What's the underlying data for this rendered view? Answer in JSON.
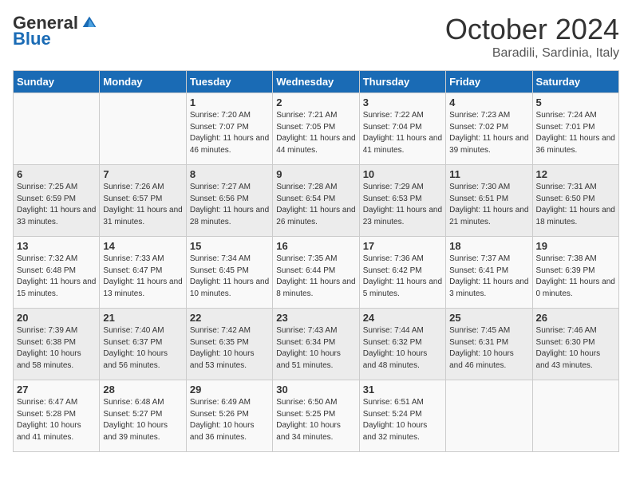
{
  "logo": {
    "general": "General",
    "blue": "Blue"
  },
  "title": "October 2024",
  "subtitle": "Baradili, Sardinia, Italy",
  "days_of_week": [
    "Sunday",
    "Monday",
    "Tuesday",
    "Wednesday",
    "Thursday",
    "Friday",
    "Saturday"
  ],
  "weeks": [
    [
      {
        "day": "",
        "info": ""
      },
      {
        "day": "",
        "info": ""
      },
      {
        "day": "1",
        "info": "Sunrise: 7:20 AM\nSunset: 7:07 PM\nDaylight: 11 hours and 46 minutes."
      },
      {
        "day": "2",
        "info": "Sunrise: 7:21 AM\nSunset: 7:05 PM\nDaylight: 11 hours and 44 minutes."
      },
      {
        "day": "3",
        "info": "Sunrise: 7:22 AM\nSunset: 7:04 PM\nDaylight: 11 hours and 41 minutes."
      },
      {
        "day": "4",
        "info": "Sunrise: 7:23 AM\nSunset: 7:02 PM\nDaylight: 11 hours and 39 minutes."
      },
      {
        "day": "5",
        "info": "Sunrise: 7:24 AM\nSunset: 7:01 PM\nDaylight: 11 hours and 36 minutes."
      }
    ],
    [
      {
        "day": "6",
        "info": "Sunrise: 7:25 AM\nSunset: 6:59 PM\nDaylight: 11 hours and 33 minutes."
      },
      {
        "day": "7",
        "info": "Sunrise: 7:26 AM\nSunset: 6:57 PM\nDaylight: 11 hours and 31 minutes."
      },
      {
        "day": "8",
        "info": "Sunrise: 7:27 AM\nSunset: 6:56 PM\nDaylight: 11 hours and 28 minutes."
      },
      {
        "day": "9",
        "info": "Sunrise: 7:28 AM\nSunset: 6:54 PM\nDaylight: 11 hours and 26 minutes."
      },
      {
        "day": "10",
        "info": "Sunrise: 7:29 AM\nSunset: 6:53 PM\nDaylight: 11 hours and 23 minutes."
      },
      {
        "day": "11",
        "info": "Sunrise: 7:30 AM\nSunset: 6:51 PM\nDaylight: 11 hours and 21 minutes."
      },
      {
        "day": "12",
        "info": "Sunrise: 7:31 AM\nSunset: 6:50 PM\nDaylight: 11 hours and 18 minutes."
      }
    ],
    [
      {
        "day": "13",
        "info": "Sunrise: 7:32 AM\nSunset: 6:48 PM\nDaylight: 11 hours and 15 minutes."
      },
      {
        "day": "14",
        "info": "Sunrise: 7:33 AM\nSunset: 6:47 PM\nDaylight: 11 hours and 13 minutes."
      },
      {
        "day": "15",
        "info": "Sunrise: 7:34 AM\nSunset: 6:45 PM\nDaylight: 11 hours and 10 minutes."
      },
      {
        "day": "16",
        "info": "Sunrise: 7:35 AM\nSunset: 6:44 PM\nDaylight: 11 hours and 8 minutes."
      },
      {
        "day": "17",
        "info": "Sunrise: 7:36 AM\nSunset: 6:42 PM\nDaylight: 11 hours and 5 minutes."
      },
      {
        "day": "18",
        "info": "Sunrise: 7:37 AM\nSunset: 6:41 PM\nDaylight: 11 hours and 3 minutes."
      },
      {
        "day": "19",
        "info": "Sunrise: 7:38 AM\nSunset: 6:39 PM\nDaylight: 11 hours and 0 minutes."
      }
    ],
    [
      {
        "day": "20",
        "info": "Sunrise: 7:39 AM\nSunset: 6:38 PM\nDaylight: 10 hours and 58 minutes."
      },
      {
        "day": "21",
        "info": "Sunrise: 7:40 AM\nSunset: 6:37 PM\nDaylight: 10 hours and 56 minutes."
      },
      {
        "day": "22",
        "info": "Sunrise: 7:42 AM\nSunset: 6:35 PM\nDaylight: 10 hours and 53 minutes."
      },
      {
        "day": "23",
        "info": "Sunrise: 7:43 AM\nSunset: 6:34 PM\nDaylight: 10 hours and 51 minutes."
      },
      {
        "day": "24",
        "info": "Sunrise: 7:44 AM\nSunset: 6:32 PM\nDaylight: 10 hours and 48 minutes."
      },
      {
        "day": "25",
        "info": "Sunrise: 7:45 AM\nSunset: 6:31 PM\nDaylight: 10 hours and 46 minutes."
      },
      {
        "day": "26",
        "info": "Sunrise: 7:46 AM\nSunset: 6:30 PM\nDaylight: 10 hours and 43 minutes."
      }
    ],
    [
      {
        "day": "27",
        "info": "Sunrise: 6:47 AM\nSunset: 5:28 PM\nDaylight: 10 hours and 41 minutes."
      },
      {
        "day": "28",
        "info": "Sunrise: 6:48 AM\nSunset: 5:27 PM\nDaylight: 10 hours and 39 minutes."
      },
      {
        "day": "29",
        "info": "Sunrise: 6:49 AM\nSunset: 5:26 PM\nDaylight: 10 hours and 36 minutes."
      },
      {
        "day": "30",
        "info": "Sunrise: 6:50 AM\nSunset: 5:25 PM\nDaylight: 10 hours and 34 minutes."
      },
      {
        "day": "31",
        "info": "Sunrise: 6:51 AM\nSunset: 5:24 PM\nDaylight: 10 hours and 32 minutes."
      },
      {
        "day": "",
        "info": ""
      },
      {
        "day": "",
        "info": ""
      }
    ]
  ]
}
